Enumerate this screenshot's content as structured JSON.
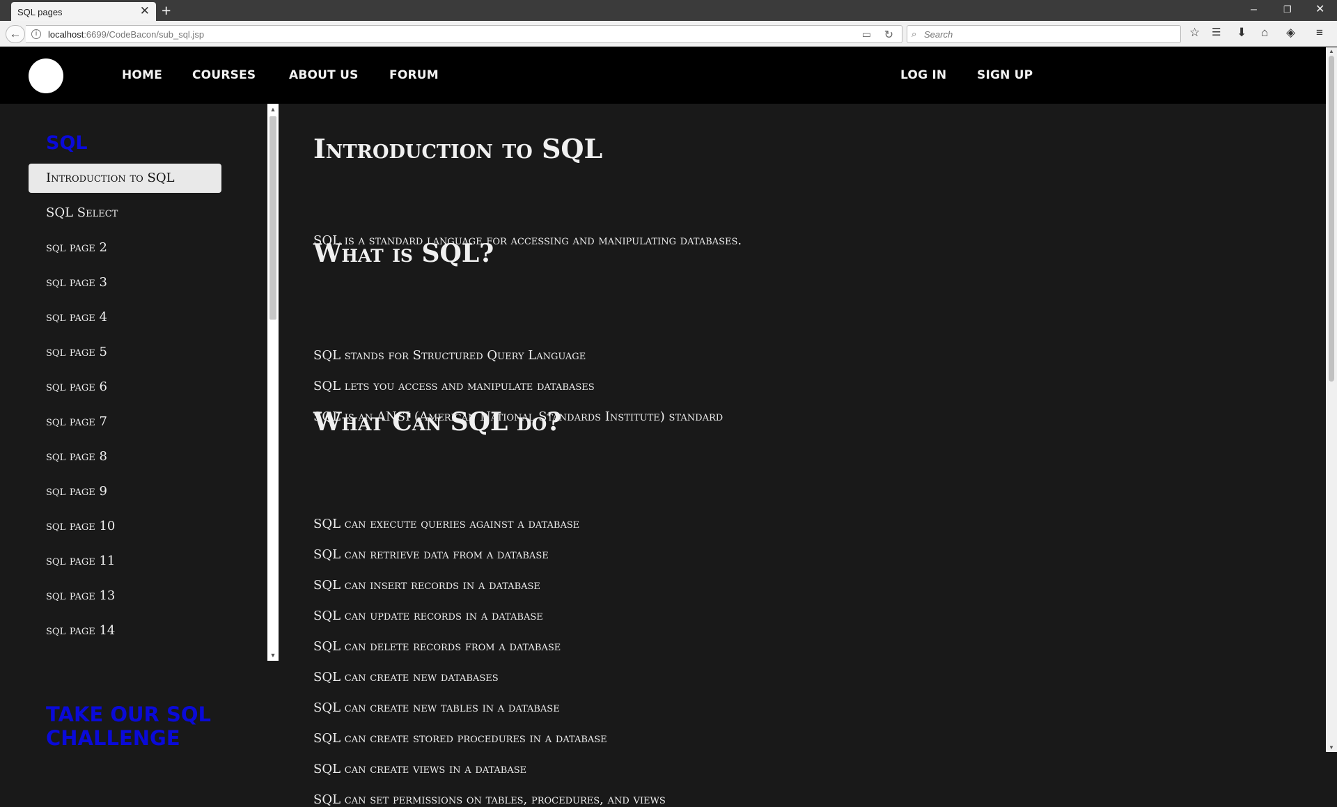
{
  "browser": {
    "tab_title": "SQL pages",
    "url_host": "localhost",
    "url_rest": ":6699/CodeBacon/sub_sql.jsp",
    "search_placeholder": "Search"
  },
  "nav": {
    "left": [
      "HOME",
      "COURSES",
      "ABOUT US",
      "FORUM"
    ],
    "right": [
      "LOG IN",
      "SIGN UP"
    ]
  },
  "sidebar": {
    "heading": "SQL",
    "items": [
      {
        "label": "Introduction to SQL",
        "active": true
      },
      {
        "label": "SQL Select"
      },
      {
        "label": "sql page 2"
      },
      {
        "label": "sql page 3"
      },
      {
        "label": "sql page 4"
      },
      {
        "label": "sql page 5"
      },
      {
        "label": "sql page 6"
      },
      {
        "label": "sql page 7"
      },
      {
        "label": "sql page 8"
      },
      {
        "label": "sql page 9"
      },
      {
        "label": "sql page 10"
      },
      {
        "label": "sql page 11"
      },
      {
        "label": "sql page 13"
      },
      {
        "label": "sql page 14"
      }
    ],
    "challenge": "TAKE OUR SQL CHALLENGE"
  },
  "content": {
    "title": "Introduction to SQL",
    "intro": "SQL is a standard language for accessing and manipulating databases.",
    "what_heading": "What is SQL?",
    "what_items": [
      "SQL stands for Structured Query Language",
      "SQL lets you access and manipulate databases",
      "SQL is an ANSI (American National Standards Institute) standard"
    ],
    "can_heading": "What Can SQL do?",
    "can_items": [
      "SQL can execute queries against a database",
      "SQL can retrieve data from a database",
      "SQL can insert records in a database",
      "SQL can update records in a database",
      "SQL can delete records from a database",
      "SQL can create new databases",
      "SQL can create new tables in a database",
      "SQL can create stored procedures in a database",
      "SQL can create views in a database",
      "SQL can set permissions on tables, procedures, and views"
    ]
  }
}
